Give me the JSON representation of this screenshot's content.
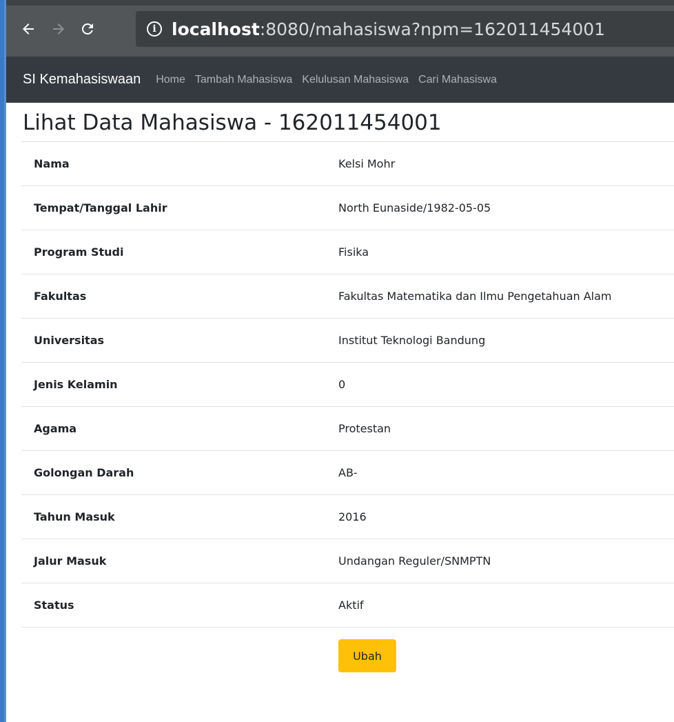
{
  "browser": {
    "url_host": "localhost",
    "url_rest": ":8080/mahasiswa?npm=162011454001",
    "icons": {
      "back": "back-arrow-icon",
      "forward": "forward-arrow-icon",
      "reload": "reload-icon",
      "info": "info-icon"
    }
  },
  "navbar": {
    "brand": "SI Kemahasiswaan",
    "links": [
      "Home",
      "Tambah Mahasiswa",
      "Kelulusan Mahasiswa",
      "Cari Mahasiswa"
    ]
  },
  "page": {
    "title": "Lihat Data Mahasiswa - 162011454001"
  },
  "details": [
    {
      "label": "Nama",
      "value": "Kelsi Mohr"
    },
    {
      "label": "Tempat/Tanggal Lahir",
      "value": "North Eunaside/1982-05-05"
    },
    {
      "label": "Program Studi",
      "value": "Fisika"
    },
    {
      "label": "Fakultas",
      "value": "Fakultas Matematika dan Ilmu Pengetahuan Alam"
    },
    {
      "label": "Universitas",
      "value": "Institut Teknologi Bandung"
    },
    {
      "label": "Jenis Kelamin",
      "value": "0"
    },
    {
      "label": "Agama",
      "value": "Protestan"
    },
    {
      "label": "Golongan Darah",
      "value": "AB-"
    },
    {
      "label": "Tahun Masuk",
      "value": "2016"
    },
    {
      "label": "Jalur Masuk",
      "value": "Undangan Reguler/SNMPTN"
    },
    {
      "label": "Status",
      "value": "Aktif"
    }
  ],
  "actions": {
    "edit_label": "Ubah"
  },
  "colors": {
    "navbar": "#343a40",
    "browser": "#525659",
    "button": "#ffc107"
  }
}
